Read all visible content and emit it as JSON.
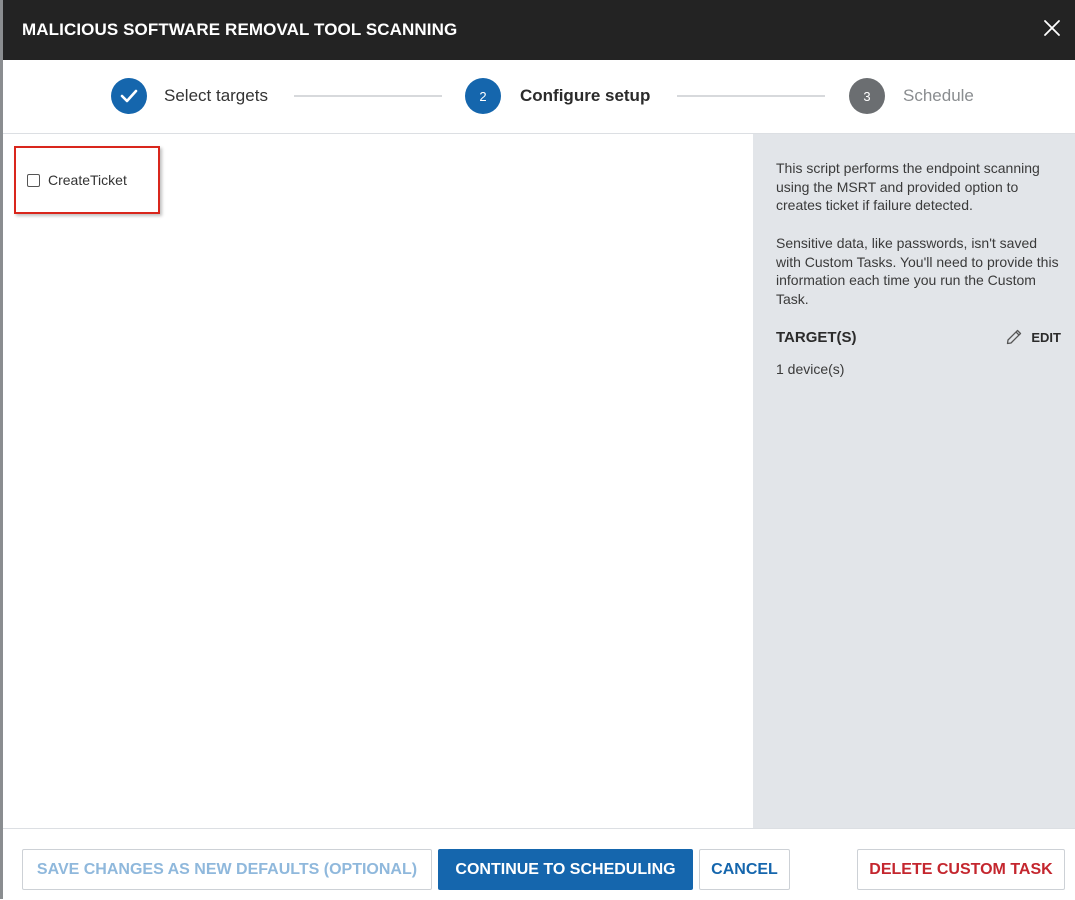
{
  "dialog": {
    "title": "MALICIOUS SOFTWARE REMOVAL TOOL SCANNING"
  },
  "steps": [
    {
      "label": "Select targets",
      "state": "completed",
      "number": "1"
    },
    {
      "label": "Configure setup",
      "state": "active",
      "number": "2"
    },
    {
      "label": "Schedule",
      "state": "pending",
      "number": "3"
    }
  ],
  "colors": {
    "title_bg": "#232323",
    "accent": "#1566ad",
    "step_pending": "#6b6e71",
    "side_bg": "#e2e5e9",
    "highlight": "#d9261c",
    "danger": "#c4262e"
  },
  "form": {
    "create_ticket": {
      "label": "CreateTicket",
      "checked": false
    }
  },
  "side": {
    "description": "This script performs the endpoint scanning using the MSRT and provided option to creates ticket if failure detected.",
    "sensitive_note": "Sensitive data, like passwords, isn't saved with Custom Tasks. You'll need to provide this information each time you run the Custom Task.",
    "targets_heading": "TARGET(S)",
    "edit_label": "EDIT",
    "targets_value": "1 device(s)"
  },
  "footer": {
    "save_defaults": "SAVE CHANGES AS NEW DEFAULTS (OPTIONAL)",
    "continue": "CONTINUE TO SCHEDULING",
    "cancel": "CANCEL",
    "delete": "DELETE CUSTOM TASK"
  }
}
